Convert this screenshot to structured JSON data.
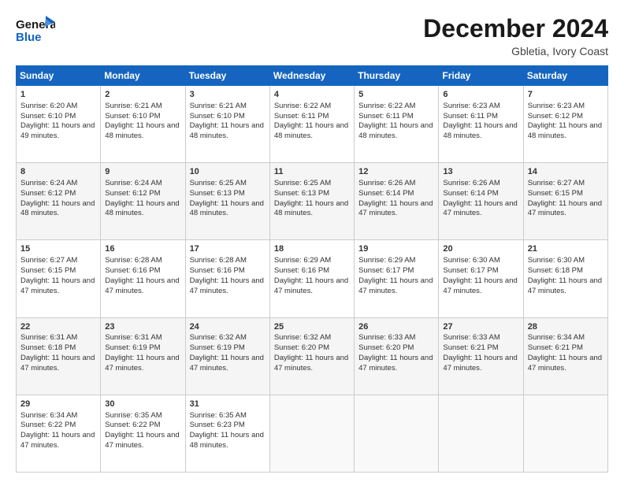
{
  "header": {
    "logo_line1": "General",
    "logo_line2": "Blue",
    "month_title": "December 2024",
    "subtitle": "Gbletia, Ivory Coast"
  },
  "days_of_week": [
    "Sunday",
    "Monday",
    "Tuesday",
    "Wednesday",
    "Thursday",
    "Friday",
    "Saturday"
  ],
  "weeks": [
    [
      {
        "day": "1",
        "sunrise": "6:20 AM",
        "sunset": "6:10 PM",
        "daylight": "11 hours and 49 minutes."
      },
      {
        "day": "2",
        "sunrise": "6:21 AM",
        "sunset": "6:10 PM",
        "daylight": "11 hours and 48 minutes."
      },
      {
        "day": "3",
        "sunrise": "6:21 AM",
        "sunset": "6:10 PM",
        "daylight": "11 hours and 48 minutes."
      },
      {
        "day": "4",
        "sunrise": "6:22 AM",
        "sunset": "6:11 PM",
        "daylight": "11 hours and 48 minutes."
      },
      {
        "day": "5",
        "sunrise": "6:22 AM",
        "sunset": "6:11 PM",
        "daylight": "11 hours and 48 minutes."
      },
      {
        "day": "6",
        "sunrise": "6:23 AM",
        "sunset": "6:11 PM",
        "daylight": "11 hours and 48 minutes."
      },
      {
        "day": "7",
        "sunrise": "6:23 AM",
        "sunset": "6:12 PM",
        "daylight": "11 hours and 48 minutes."
      }
    ],
    [
      {
        "day": "8",
        "sunrise": "6:24 AM",
        "sunset": "6:12 PM",
        "daylight": "11 hours and 48 minutes."
      },
      {
        "day": "9",
        "sunrise": "6:24 AM",
        "sunset": "6:12 PM",
        "daylight": "11 hours and 48 minutes."
      },
      {
        "day": "10",
        "sunrise": "6:25 AM",
        "sunset": "6:13 PM",
        "daylight": "11 hours and 48 minutes."
      },
      {
        "day": "11",
        "sunrise": "6:25 AM",
        "sunset": "6:13 PM",
        "daylight": "11 hours and 48 minutes."
      },
      {
        "day": "12",
        "sunrise": "6:26 AM",
        "sunset": "6:14 PM",
        "daylight": "11 hours and 47 minutes."
      },
      {
        "day": "13",
        "sunrise": "6:26 AM",
        "sunset": "6:14 PM",
        "daylight": "11 hours and 47 minutes."
      },
      {
        "day": "14",
        "sunrise": "6:27 AM",
        "sunset": "6:15 PM",
        "daylight": "11 hours and 47 minutes."
      }
    ],
    [
      {
        "day": "15",
        "sunrise": "6:27 AM",
        "sunset": "6:15 PM",
        "daylight": "11 hours and 47 minutes."
      },
      {
        "day": "16",
        "sunrise": "6:28 AM",
        "sunset": "6:16 PM",
        "daylight": "11 hours and 47 minutes."
      },
      {
        "day": "17",
        "sunrise": "6:28 AM",
        "sunset": "6:16 PM",
        "daylight": "11 hours and 47 minutes."
      },
      {
        "day": "18",
        "sunrise": "6:29 AM",
        "sunset": "6:16 PM",
        "daylight": "11 hours and 47 minutes."
      },
      {
        "day": "19",
        "sunrise": "6:29 AM",
        "sunset": "6:17 PM",
        "daylight": "11 hours and 47 minutes."
      },
      {
        "day": "20",
        "sunrise": "6:30 AM",
        "sunset": "6:17 PM",
        "daylight": "11 hours and 47 minutes."
      },
      {
        "day": "21",
        "sunrise": "6:30 AM",
        "sunset": "6:18 PM",
        "daylight": "11 hours and 47 minutes."
      }
    ],
    [
      {
        "day": "22",
        "sunrise": "6:31 AM",
        "sunset": "6:18 PM",
        "daylight": "11 hours and 47 minutes."
      },
      {
        "day": "23",
        "sunrise": "6:31 AM",
        "sunset": "6:19 PM",
        "daylight": "11 hours and 47 minutes."
      },
      {
        "day": "24",
        "sunrise": "6:32 AM",
        "sunset": "6:19 PM",
        "daylight": "11 hours and 47 minutes."
      },
      {
        "day": "25",
        "sunrise": "6:32 AM",
        "sunset": "6:20 PM",
        "daylight": "11 hours and 47 minutes."
      },
      {
        "day": "26",
        "sunrise": "6:33 AM",
        "sunset": "6:20 PM",
        "daylight": "11 hours and 47 minutes."
      },
      {
        "day": "27",
        "sunrise": "6:33 AM",
        "sunset": "6:21 PM",
        "daylight": "11 hours and 47 minutes."
      },
      {
        "day": "28",
        "sunrise": "6:34 AM",
        "sunset": "6:21 PM",
        "daylight": "11 hours and 47 minutes."
      }
    ],
    [
      {
        "day": "29",
        "sunrise": "6:34 AM",
        "sunset": "6:22 PM",
        "daylight": "11 hours and 47 minutes."
      },
      {
        "day": "30",
        "sunrise": "6:35 AM",
        "sunset": "6:22 PM",
        "daylight": "11 hours and 47 minutes."
      },
      {
        "day": "31",
        "sunrise": "6:35 AM",
        "sunset": "6:23 PM",
        "daylight": "11 hours and 48 minutes."
      },
      null,
      null,
      null,
      null
    ]
  ]
}
